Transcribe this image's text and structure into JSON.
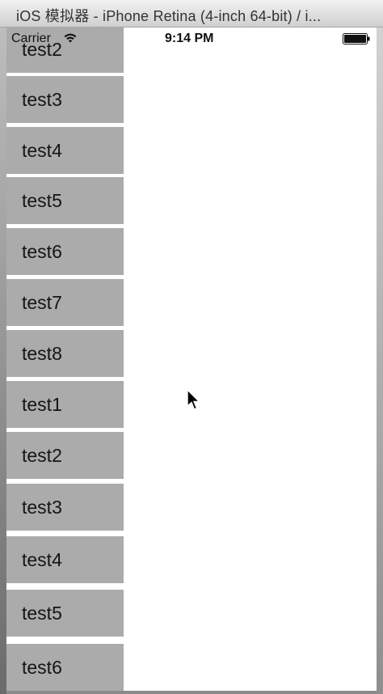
{
  "window": {
    "title": "iOS 模拟器 - iPhone Retina (4-inch 64-bit) / i..."
  },
  "statusbar": {
    "carrier": "Carrier",
    "time": "9:14 PM",
    "wifi_icon": "wifi-icon",
    "battery_icon": "battery-icon"
  },
  "menu": {
    "items": [
      {
        "label": "test2"
      },
      {
        "label": "test3"
      },
      {
        "label": "test4"
      },
      {
        "label": "test5"
      },
      {
        "label": "test6"
      },
      {
        "label": "test7"
      },
      {
        "label": "test8"
      },
      {
        "label": "test1"
      },
      {
        "label": "test2"
      },
      {
        "label": "test3"
      },
      {
        "label": "test4"
      },
      {
        "label": "test5"
      },
      {
        "label": "test6"
      }
    ]
  },
  "colors": {
    "menu_item_bg": "#ababab",
    "screen_bg": "#ffffff"
  }
}
